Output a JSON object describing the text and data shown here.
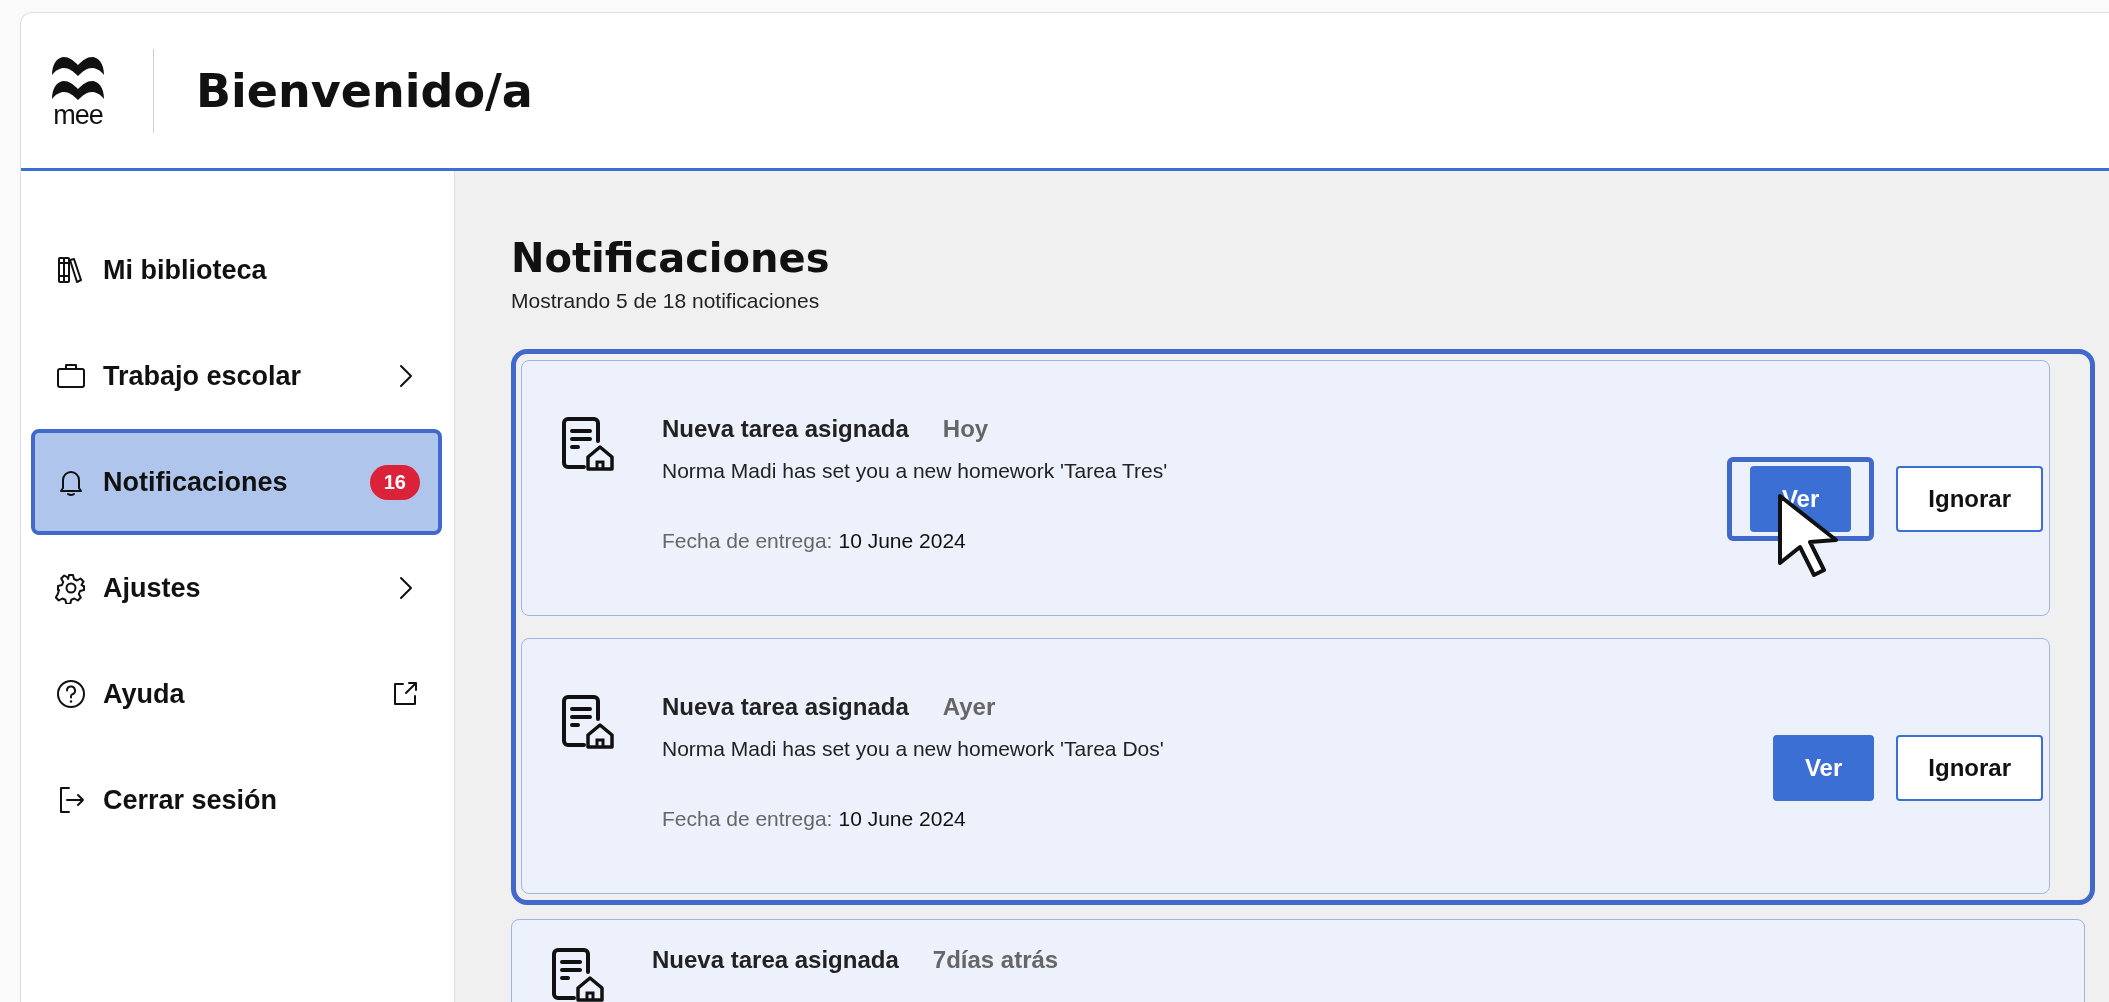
{
  "header": {
    "logo_text": "mee",
    "title": "Bienvenido/a"
  },
  "sidebar": {
    "items": [
      {
        "label": "Mi biblioteca",
        "kind": "books",
        "has_submenu": false,
        "external": false,
        "selected": false
      },
      {
        "label": "Trabajo escolar",
        "kind": "briefcase",
        "has_submenu": true,
        "external": false,
        "selected": false
      },
      {
        "label": "Notificaciones",
        "kind": "bell",
        "has_submenu": false,
        "external": false,
        "badge": "16",
        "selected": true
      },
      {
        "label": "Ajustes",
        "kind": "gear",
        "has_submenu": true,
        "external": false,
        "selected": false
      },
      {
        "label": "Ayuda",
        "kind": "help",
        "has_submenu": false,
        "external": true,
        "selected": false
      },
      {
        "label": "Cerrar sesión",
        "kind": "logout",
        "has_submenu": false,
        "external": false,
        "selected": false
      }
    ]
  },
  "main": {
    "title": "Notificaciones",
    "subtitle": "Mostrando 5 de 18 notificaciones",
    "notifications": [
      {
        "title": "Nueva tarea asignada",
        "time": "Hoy",
        "message": "Norma Madi has set you a new homework 'Tarea Tres'",
        "due_label": "Fecha de entrega:",
        "due_date": "10 June 2024",
        "highlighted": true,
        "actions": [
          {
            "label": "Ver",
            "kind": "primary",
            "highlighted": true,
            "hovered": true
          },
          {
            "label": "Ignorar",
            "kind": "secondary",
            "highlighted": false,
            "hovered": false
          }
        ]
      },
      {
        "title": "Nueva tarea asignada",
        "time": "Ayer",
        "message": "Norma Madi has set you a new homework 'Tarea Dos'",
        "due_label": "Fecha de entrega:",
        "due_date": "10 June 2024",
        "highlighted": true,
        "actions": [
          {
            "label": "Ver",
            "kind": "primary",
            "highlighted": false,
            "hovered": false
          },
          {
            "label": "Ignorar",
            "kind": "secondary",
            "highlighted": false,
            "hovered": false
          }
        ]
      },
      {
        "title": "Nueva tarea asignada",
        "time": "7días atrás",
        "highlighted": false
      }
    ]
  }
}
